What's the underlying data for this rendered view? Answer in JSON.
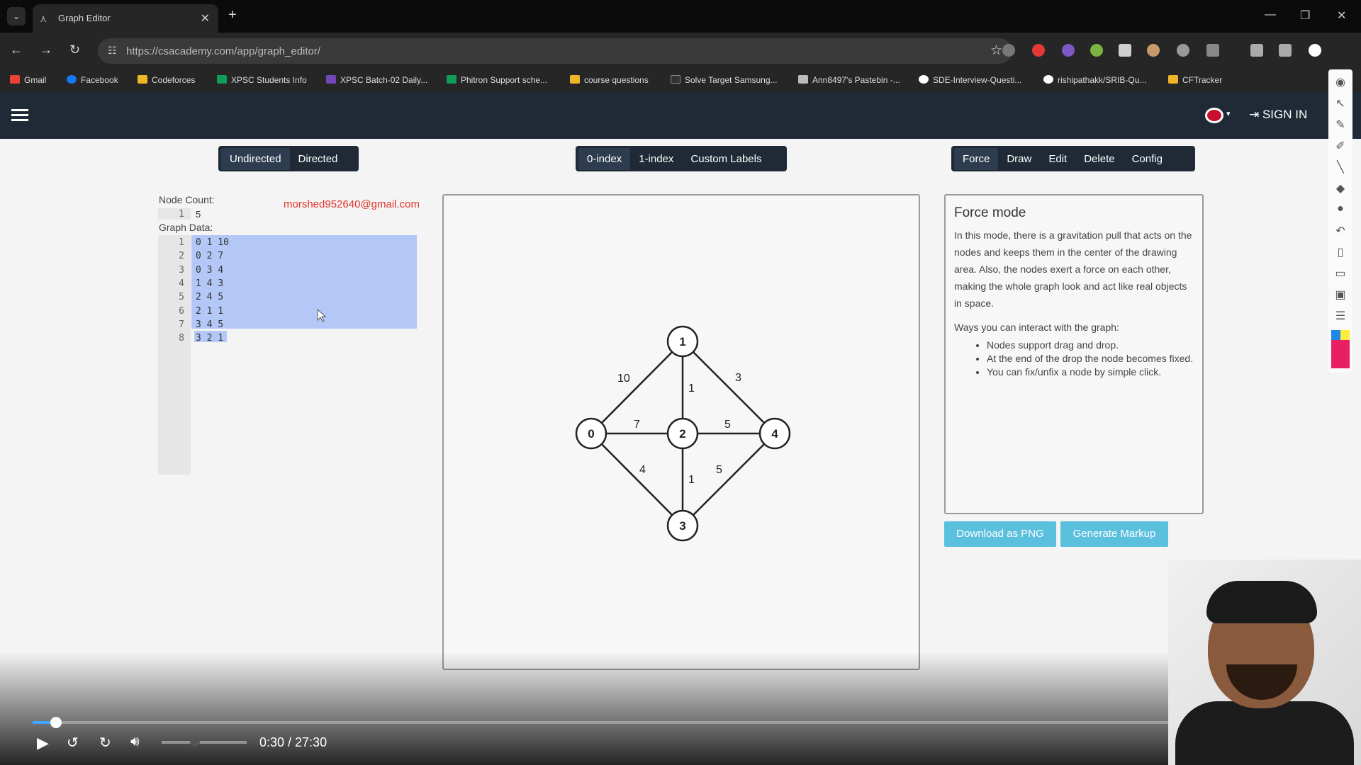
{
  "browser": {
    "tab_title": "Graph Editor",
    "url": "https://csacademy.com/app/graph_editor/",
    "bookmarks": [
      "Gmail",
      "Facebook",
      "Codeforces",
      "XPSC Students Info",
      "XPSC Batch-02 Daily...",
      "Phitron Support sche...",
      "course questions",
      "Solve Target Samsung...",
      "Ann8497's Pastebin -...",
      "SDE-Interview-Questi...",
      "rishipathakk/SRIB-Qu...",
      "CFTracker"
    ]
  },
  "header": {
    "sign_in": "SIGN IN"
  },
  "toolbar": {
    "direction": [
      "Undirected",
      "Directed"
    ],
    "indexing": [
      "0-index",
      "1-index",
      "Custom Labels"
    ],
    "modes": [
      "Force",
      "Draw",
      "Edit",
      "Delete",
      "Config"
    ]
  },
  "editor": {
    "node_count_label": "Node Count:",
    "node_count_line": "1",
    "node_count_value": "5",
    "graph_data_label": "Graph Data:",
    "email": "morshed952640@gmail.com",
    "lines": [
      "0 1 10",
      "0 2 7",
      "0 3 4",
      "1 4 3",
      "2 4 5",
      "2 1 1",
      "3 4 5",
      "3 2 1"
    ]
  },
  "graph": {
    "nodes": [
      "0",
      "1",
      "2",
      "3",
      "4"
    ],
    "edge_weights": [
      "10",
      "3",
      "1",
      "7",
      "5",
      "4",
      "1",
      "5"
    ]
  },
  "info": {
    "title": "Force mode",
    "paragraph": "In this mode, there is a gravitation pull that acts on the nodes and keeps them in the center of the drawing area. Also, the nodes exert a force on each other, making the whole graph look and act like real objects in space.",
    "ways": "Ways you can interact with the graph:",
    "bullets": [
      "Nodes support drag and drop.",
      "At the end of the drop the node becomes fixed.",
      "You can fix/unfix a node by simple click."
    ]
  },
  "actions": {
    "download": "Download as PNG",
    "markup": "Generate Markup"
  },
  "video": {
    "timecode": "0:30 / 27:30",
    "progress_fraction": 0.018
  }
}
